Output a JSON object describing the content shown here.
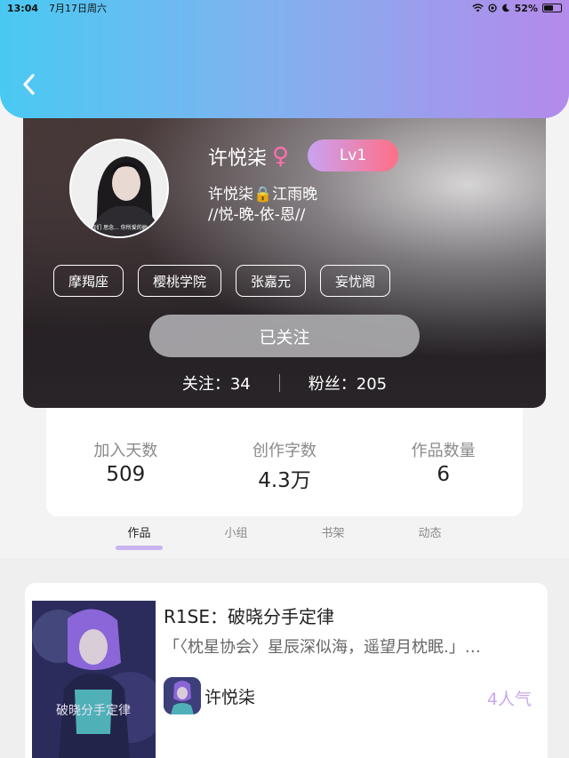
{
  "status_bar": {
    "time": "13:04",
    "date": "7月17日周六",
    "battery": "52%",
    "icons": [
      "wifi-icon",
      "location-icon",
      "moon-icon",
      "battery-icon"
    ]
  },
  "header": {
    "back_icon": "chevron-left-icon",
    "colors": {
      "gradient_start": "#49c9f2",
      "gradient_end": "#b48aea"
    }
  },
  "profile": {
    "nickname": "许悦柒",
    "gender_icon": "♀",
    "level": "Lv1",
    "signature_line1": "许悦柒🔒江雨晚",
    "signature_line2": "//悦-晚-依-恩//",
    "avatar_caption": "我们 思念... 你所爱的她",
    "tags": [
      "摩羯座",
      "樱桃学院",
      "张嘉元",
      "妄忧阁"
    ],
    "follow_button": "已关注",
    "following_label": "关注：34",
    "followers_label": "粉丝：205"
  },
  "stats": [
    {
      "label": "加入天数",
      "value": "509"
    },
    {
      "label": "创作字数",
      "value": "4.3万"
    },
    {
      "label": "作品数量",
      "value": "6"
    }
  ],
  "tabs": [
    {
      "label": "作品",
      "active": true
    },
    {
      "label": "小组",
      "active": false
    },
    {
      "label": "书架",
      "active": false
    },
    {
      "label": "动态",
      "active": false
    }
  ],
  "work": {
    "title": "R1SE：破晓分手定律",
    "description": "「〈枕星协会〉星辰深似海，遥望月枕眠.」…",
    "cover_text": "破晓分手定律",
    "author": "许悦柒",
    "popularity": "4人气"
  },
  "colors": {
    "accent_purple": "#c9a8ee",
    "level_badge_start": "#c9a2f2",
    "level_badge_end": "#ff6f86"
  }
}
